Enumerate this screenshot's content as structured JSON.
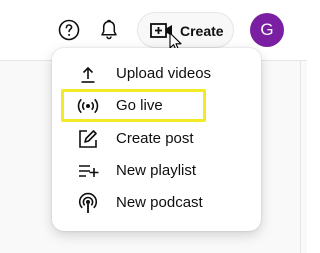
{
  "header": {
    "help_icon": "help-circle-icon",
    "notifications_icon": "bell-icon",
    "create_button": {
      "icon": "video-plus-icon",
      "label": "Create"
    },
    "avatar_initial": "G",
    "avatar_color": "#7a1fa2"
  },
  "create_menu": {
    "items": [
      {
        "label": "Upload videos",
        "icon": "upload-icon"
      },
      {
        "label": "Go live",
        "icon": "broadcast-icon"
      },
      {
        "label": "Create post",
        "icon": "edit-post-icon"
      },
      {
        "label": "New playlist",
        "icon": "playlist-add-icon"
      },
      {
        "label": "New podcast",
        "icon": "podcast-icon"
      }
    ]
  },
  "highlight_color": "#f2ea27"
}
